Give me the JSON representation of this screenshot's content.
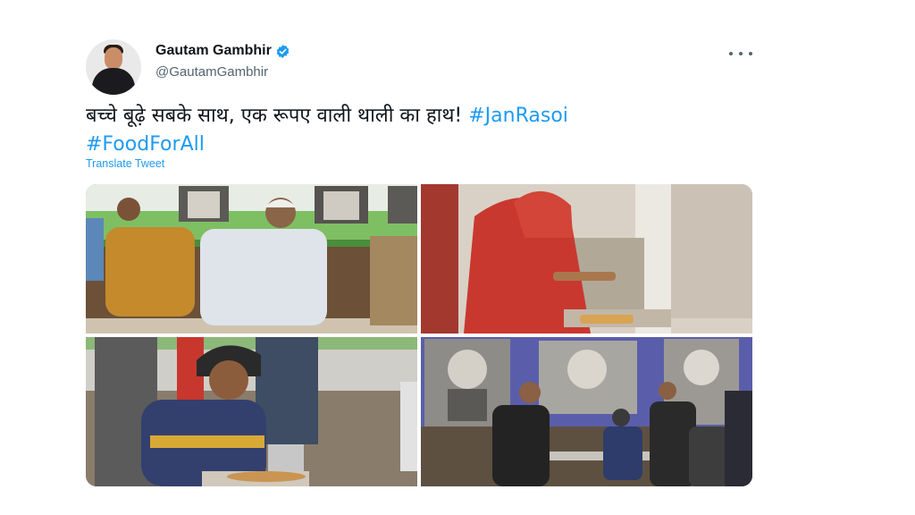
{
  "tweet": {
    "author_name": "Gautam Gambhir",
    "author_handle": "@GautamGambhir",
    "text_main": "बच्चे बूढ़े सबके साथ, एक रूपए वाली थाली का हाथ!",
    "hashtags": [
      "#JanRasoi",
      "#FoodForAll"
    ],
    "translate_label": "Translate Tweet",
    "verified": true,
    "more_icon": "more-horizontal-icon"
  },
  "colors": {
    "link": "#1d9bf0",
    "text": "#0f1419",
    "secondary": "#536471"
  }
}
